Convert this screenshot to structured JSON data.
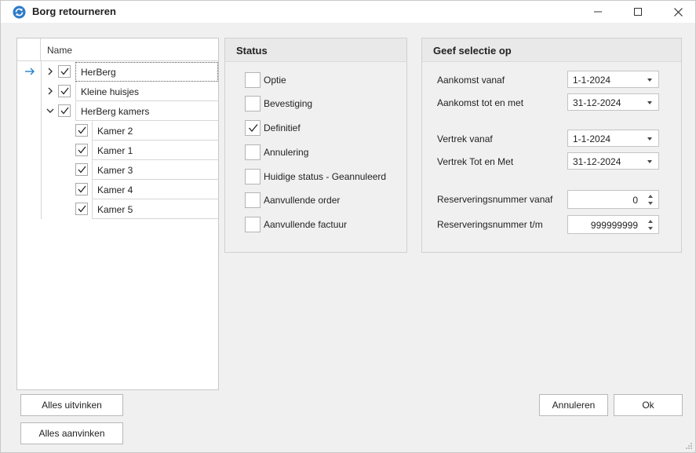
{
  "window": {
    "title": "Borg retourneren",
    "app_icon": "refresh-arrows-icon",
    "controls": [
      "minimize-icon",
      "maximize-icon",
      "close-icon"
    ]
  },
  "tree": {
    "column_header": "Name",
    "rows": [
      {
        "label": "HerBerg",
        "level": 0,
        "expander": "collapsed",
        "checked": true,
        "current": true
      },
      {
        "label": "Kleine huisjes",
        "level": 0,
        "expander": "collapsed",
        "checked": true
      },
      {
        "label": "HerBerg kamers",
        "level": 0,
        "expander": "expanded",
        "checked": true
      },
      {
        "label": "Kamer 2",
        "level": 1,
        "checked": true
      },
      {
        "label": "Kamer 1",
        "level": 1,
        "checked": true
      },
      {
        "label": "Kamer 3",
        "level": 1,
        "checked": true
      },
      {
        "label": "Kamer 4",
        "level": 1,
        "checked": true
      },
      {
        "label": "Kamer 5",
        "level": 1,
        "checked": true
      }
    ]
  },
  "status": {
    "title": "Status",
    "items": [
      {
        "label": "Optie",
        "checked": false
      },
      {
        "label": "Bevestiging",
        "checked": false
      },
      {
        "label": "Definitief",
        "checked": true
      },
      {
        "label": "Annulering",
        "checked": false
      },
      {
        "label": "Huidige status - Geannuleerd",
        "checked": false
      },
      {
        "label": "Aanvullende order",
        "checked": false
      },
      {
        "label": "Aanvullende factuur",
        "checked": false
      }
    ]
  },
  "selection": {
    "title": "Geef selectie op",
    "aankomst_vanaf": {
      "label": "Aankomst vanaf",
      "value": "1-1-2024"
    },
    "aankomst_tot": {
      "label": "Aankomst tot en met",
      "value": "31-12-2024"
    },
    "vertrek_vanaf": {
      "label": "Vertrek vanaf",
      "value": "1-1-2024"
    },
    "vertrek_tot": {
      "label": "Vertrek Tot en Met",
      "value": "31-12-2024"
    },
    "res_vanaf": {
      "label": "Reserveringsnummer vanaf",
      "value": "0"
    },
    "res_tm": {
      "label": "Reserveringsnummer t/m",
      "value": "999999999"
    }
  },
  "buttons": {
    "uncheck_all": "Alles uitvinken",
    "check_all": "Alles aanvinken",
    "cancel": "Annuleren",
    "ok": "Ok"
  },
  "colors": {
    "accent": "#1e7fd0",
    "panel_bg": "#f0f0f0",
    "header_bg": "#e9e9e9"
  }
}
